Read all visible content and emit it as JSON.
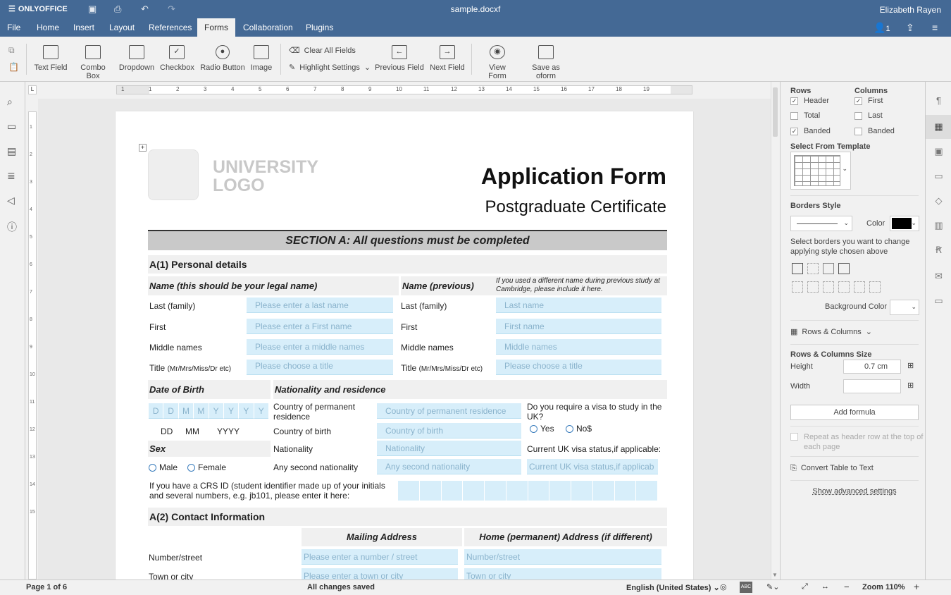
{
  "app": {
    "brand": "ONLYOFFICE",
    "doc_title": "sample.docxf",
    "user": "Elizabeth Rayen",
    "user_count": "1"
  },
  "menu": {
    "tabs": [
      "File",
      "Home",
      "Insert",
      "Layout",
      "References",
      "Forms",
      "Collaboration",
      "Plugins"
    ],
    "active": "Forms"
  },
  "ribbon": {
    "text_field": "Text Field",
    "combo_box": "Combo Box",
    "dropdown": "Dropdown",
    "checkbox": "Checkbox",
    "radio_button": "Radio Button",
    "image": "Image",
    "clear_all": "Clear All Fields",
    "highlight": "Highlight Settings",
    "prev_field": "Previous Field",
    "next_field": "Next Field",
    "view_form": "View Form",
    "save_oform": "Save as oform"
  },
  "ruler": {
    "h_ticks": [
      "1",
      "1",
      "2",
      "3",
      "4",
      "5",
      "6",
      "7",
      "8",
      "9",
      "10",
      "11",
      "12",
      "13",
      "14",
      "15",
      "16",
      "17",
      "18",
      "19"
    ],
    "v_ticks": [
      "1",
      "2",
      "3",
      "4",
      "5",
      "6",
      "7",
      "8",
      "9",
      "10",
      "11",
      "12",
      "13",
      "14",
      "15"
    ]
  },
  "doc": {
    "logo_line1": "UNIVERSITY",
    "logo_line2": "LOGO",
    "title": "Application Form",
    "subtitle": "Postgraduate Certificate",
    "section_a": "SECTION A: All questions must be completed",
    "personal": "A(1) Personal details",
    "name_legal": "Name (this should be your legal name)",
    "name_prev": "Name (previous)",
    "name_prev_note": "If you used a different name during previous study at Cambridge, please include it here.",
    "last_family": "Last (family)",
    "first": "First",
    "middle": "Middle names",
    "title_label": "Title",
    "title_opts": "(Mr/Mrs/Miss/Dr etc)",
    "ph_last": "Please enter a last name",
    "ph_first": "Please enter a First name",
    "ph_middle": "Please enter a middle names",
    "ph_title": "Please choose a title",
    "ph_last2": "Last name",
    "ph_first2": "First name",
    "ph_middle2": "Middle names",
    "ph_title2": "Please choose a title",
    "dob": "Date of Birth",
    "nat_res": "Nationality and residence",
    "dob_cells": [
      "D",
      "D",
      "M",
      "M",
      "Y",
      "Y",
      "Y",
      "Y"
    ],
    "dd": "DD",
    "mm": "MM",
    "yyyy": "YYYY",
    "country_perm": "Country of permanent residence",
    "ph_country_perm": "Country of permanent residence",
    "country_birth": "Country of birth",
    "ph_country_birth": "Country of birth",
    "nationality": "Nationality",
    "ph_nationality": "Nationality",
    "second_nat": "Any second nationality",
    "ph_second_nat": "Any second nationality",
    "visa_q": "Do you require a visa to study in the UK?",
    "yes": "Yes",
    "no": "No$",
    "visa_status": "Current UK visa status,if applicable:",
    "ph_visa_status": "Current UK visa status,if applicab",
    "sex": "Sex",
    "male": "Male",
    "female": "Female",
    "crs": "If you have a CRS ID (student identifier made up of your initials and several numbers, e.g. jb101, please enter it here:",
    "contact": "A(2) Contact Information",
    "mailing": "Mailing Address",
    "home_addr": "Home (permanent) Address (if different)",
    "number_street": "Number/street",
    "ph_number_street": "Please enter a number / street",
    "ph_number_street2": "Number/street",
    "town": "Town or city",
    "ph_town": "Please enter a town or city",
    "ph_town2": "Town or city"
  },
  "panel": {
    "rows": "Rows",
    "columns": "Columns",
    "header": "Header",
    "total": "Total",
    "banded": "Banded",
    "first": "First",
    "last": "Last",
    "banded_c": "Banded",
    "template": "Select From Template",
    "borders_style": "Borders Style",
    "color": "Color",
    "borders_hint": "Select borders you want to change applying style chosen above",
    "bg_color": "Background Color",
    "rows_cols": "Rows & Columns",
    "rc_size": "Rows & Columns Size",
    "height": "Height",
    "height_val": "0.7 cm",
    "width": "Width",
    "add_formula": "Add formula",
    "repeat_header": "Repeat as header row at the top of each page",
    "convert": "Convert Table to Text",
    "advanced": "Show advanced settings",
    "border_color": "#000000"
  },
  "status": {
    "page": "Page 1 of 6",
    "saved": "All changes saved",
    "lang": "English (United States)",
    "zoom": "Zoom 110%"
  }
}
